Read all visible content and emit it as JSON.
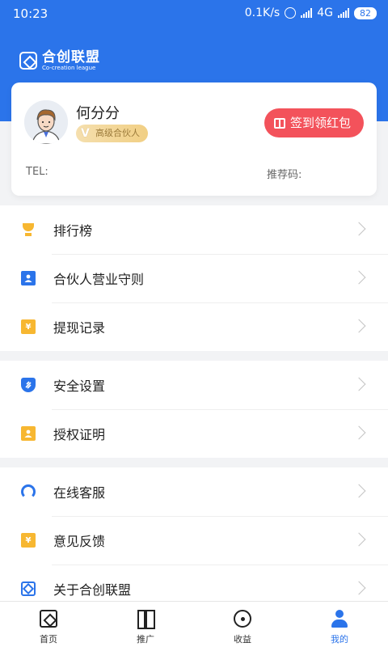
{
  "status_bar": {
    "time": "10:23",
    "speed": "0.1K/s",
    "network": "4G",
    "battery": "82"
  },
  "brand": {
    "name": "合创联盟",
    "subtitle": "Co-creation league"
  },
  "profile": {
    "name": "何分分",
    "level": "高级合伙人",
    "level_mark": "V",
    "checkin_label": "签到领红包",
    "tel_label": "TEL:",
    "referral_label": "推荐码:"
  },
  "menu_groups": [
    [
      {
        "label": "排行榜",
        "icon": "trophy-icon"
      },
      {
        "label": "合伙人营业守则",
        "icon": "person-card-icon"
      },
      {
        "label": "提现记录",
        "icon": "yuan-icon",
        "glyph": "¥"
      }
    ],
    [
      {
        "label": "安全设置",
        "icon": "shield-icon"
      },
      {
        "label": "授权证明",
        "icon": "certificate-icon"
      }
    ],
    [
      {
        "label": "在线客服",
        "icon": "headset-icon"
      },
      {
        "label": "意见反馈",
        "icon": "feedback-icon",
        "glyph": "¥"
      },
      {
        "label": "关于合创联盟",
        "icon": "brand-logo-icon"
      }
    ]
  ],
  "tabbar": [
    {
      "label": "首页",
      "icon": "home-icon"
    },
    {
      "label": "推广",
      "icon": "promotion-icon"
    },
    {
      "label": "收益",
      "icon": "earnings-icon"
    },
    {
      "label": "我的",
      "icon": "me-icon",
      "active": true
    }
  ],
  "colors": {
    "primary": "#2b74ea",
    "checkin": "#f3525b",
    "gold": "#f7b731"
  }
}
